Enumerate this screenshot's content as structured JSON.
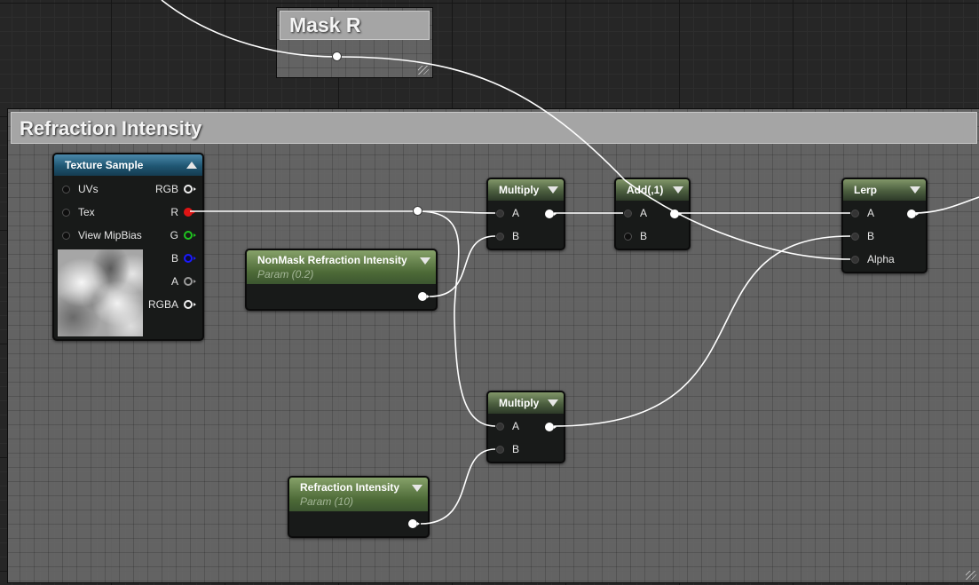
{
  "comments": {
    "mask_r": {
      "title": "Mask R"
    },
    "refraction": {
      "title": "Refraction Intensity"
    }
  },
  "texture_sample": {
    "title": "Texture Sample",
    "inputs": [
      "UVs",
      "Tex",
      "View MipBias"
    ],
    "outputs": [
      "RGB",
      "R",
      "G",
      "B",
      "A",
      "RGBA"
    ],
    "pin_colors": {
      "R": "#e01414",
      "G": "#1fc41f",
      "B": "#1a1aff"
    }
  },
  "nonmask_param": {
    "title": "NonMask Refraction Intensity",
    "subtitle": "Param (0.2)"
  },
  "refraction_param": {
    "title": "Refraction Intensity",
    "subtitle": "Param (10)"
  },
  "multiply_top": {
    "title": "Multiply",
    "pin_a": "A",
    "pin_b": "B"
  },
  "multiply_bottom": {
    "title": "Multiply",
    "pin_a": "A",
    "pin_b": "B"
  },
  "add_node": {
    "title": "Add(,1)",
    "pin_a": "A",
    "pin_b": "B"
  },
  "lerp_node": {
    "title": "Lerp",
    "pin_a": "A",
    "pin_b": "B",
    "pin_alpha": "Alpha"
  },
  "colors": {
    "node_header_green": "#4b5e3f",
    "node_header_blue": "#1f5672",
    "param_header_green": "#4d6a37",
    "wire": "#ffffff",
    "comment_header": "#a5a5a5",
    "node_body": "#181a19",
    "graph_background": "#262626"
  }
}
